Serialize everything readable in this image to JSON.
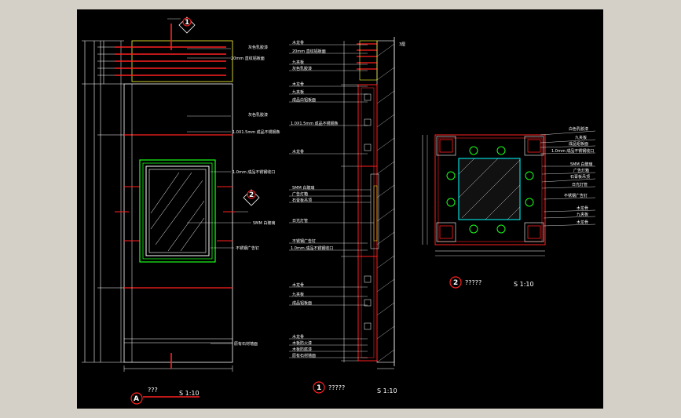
{
  "drawing": {
    "colors": {
      "background": "#000000",
      "frame": "#d4d0c8",
      "red": "#ff2020",
      "yellow": "#ffff33",
      "white": "#ffffff",
      "green": "#19ff19",
      "cyan": "#00ffff"
    },
    "elevation": {
      "labels": [
        "灰色乳胶漆",
        "20mm 直纹铝板面",
        "灰色乳胶漆",
        "1.0X1.5mm 成品不锈钢条",
        "1.0mm 成品不锈钢收口",
        "5MM 白玻璃",
        "不锈钢广告钉",
        "原有石材墙面"
      ],
      "callout_top": "1",
      "callout_mid": "2",
      "title_mark": "A",
      "title": "???",
      "scale": "S 1:10"
    },
    "section": {
      "labels": [
        "木龙骨",
        "20mm 直纹铝板面",
        "九夹板",
        "灰色乳胶漆",
        "木龙骨",
        "九夹板",
        "成品白铝板面",
        "1.0X1.5mm 成品不锈钢条",
        "木龙骨",
        "5MM 白玻璃",
        "广告灯箱",
        "石膏板吊顶",
        "日光灯管",
        "不锈钢广告钉",
        "1.0mm 成品不锈钢收口",
        "木龙骨",
        "九夹板",
        "成品铝板面",
        "木龙骨",
        "木板防火漆",
        "木板防腐漆",
        "原有石材墙面"
      ],
      "top_note": "3厘",
      "title_mark": "1",
      "title": "?????",
      "scale": "S 1:10"
    },
    "plan": {
      "labels": [
        "白色乳胶漆",
        "九夹板",
        "成品铝板面",
        "1.0mm 成品不锈钢收口",
        "5MM 白玻璃",
        "广告灯箱",
        "石膏板吊顶",
        "日光灯管",
        "不锈钢广告钉",
        "木龙骨",
        "九夹板",
        "木龙骨"
      ],
      "title_mark": "2",
      "title": "?????",
      "scale": "S 1:10"
    }
  }
}
